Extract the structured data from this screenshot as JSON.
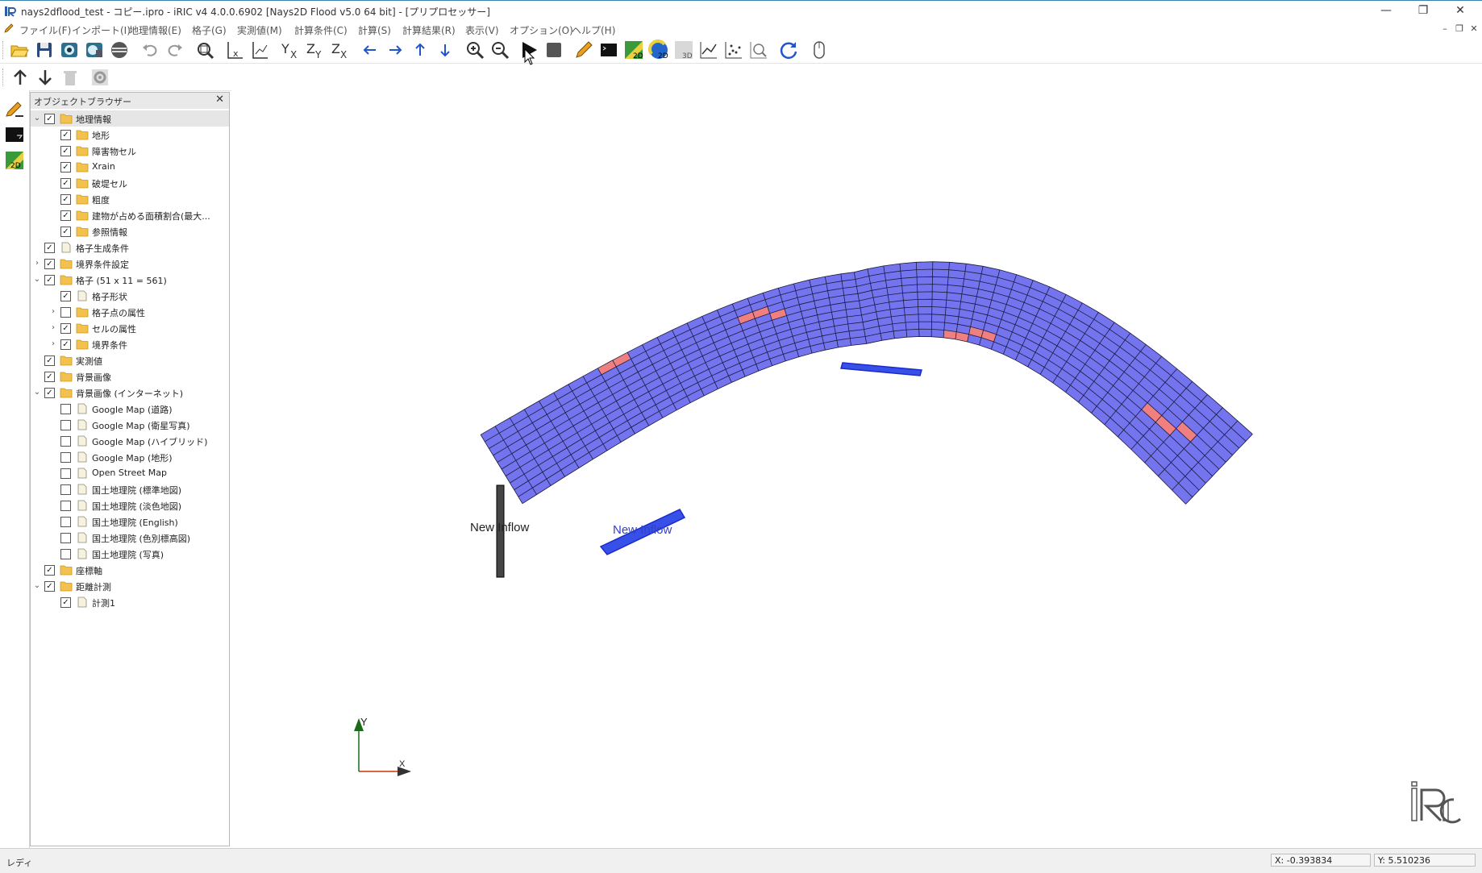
{
  "window": {
    "title": "nays2dflood_test - コピー.ipro - iRIC v4 4.0.0.6902 [Nays2D Flood v5.0 64 bit] - [プリプロセッサー]",
    "controls": {
      "minimize": "—",
      "restore": "❐",
      "close": "✕"
    }
  },
  "menu": [
    {
      "label": "ファイル(F)"
    },
    {
      "label": "インポート(I)"
    },
    {
      "label": "地理情報(E)"
    },
    {
      "label": "格子(G)"
    },
    {
      "label": "実測値(M)"
    },
    {
      "label": "計算条件(C)"
    },
    {
      "label": "計算(S)"
    },
    {
      "label": "計算結果(R)"
    },
    {
      "label": "表示(V)"
    },
    {
      "label": "オプション(O)"
    },
    {
      "label": "ヘルプ(H)"
    }
  ],
  "toolbar_icons": [
    "open-folder-icon",
    "save-icon",
    "camera-icon",
    "snapshot-icon",
    "background-icon",
    "undo-icon",
    "redo-icon",
    "fit-view-icon",
    "reset-rotation-icon",
    "axes-icon",
    "view-yx-icon",
    "view-zy-icon",
    "view-zx-icon",
    "move-left-icon",
    "move-right-icon",
    "move-up-icon",
    "move-down-icon",
    "zoom-in-icon",
    "zoom-out-icon",
    "run-icon",
    "stop-icon",
    "pencil-icon",
    "terminal-icon",
    "2d-contour-icon",
    "2d-vector-icon",
    "3d-view-icon",
    "graph-icon",
    "scatter-icon",
    "probe-icon",
    "reload-icon",
    "mouse-icon"
  ],
  "object_browser": {
    "title": "オブジェクトブラウザー",
    "close": "✕",
    "items": [
      {
        "label": "地理情報",
        "depth": 0,
        "expander": "open",
        "checked": true,
        "icon": "folder",
        "selected": true
      },
      {
        "label": "地形",
        "depth": 1,
        "expander": "none",
        "checked": true,
        "icon": "folder"
      },
      {
        "label": "障害物セル",
        "depth": 1,
        "expander": "none",
        "checked": true,
        "icon": "folder"
      },
      {
        "label": "Xrain",
        "depth": 1,
        "expander": "none",
        "checked": true,
        "icon": "folder"
      },
      {
        "label": "破堤セル",
        "depth": 1,
        "expander": "none",
        "checked": true,
        "icon": "folder"
      },
      {
        "label": "粗度",
        "depth": 1,
        "expander": "none",
        "checked": true,
        "icon": "folder"
      },
      {
        "label": "建物が占める面積割合(最大...",
        "depth": 1,
        "expander": "none",
        "checked": true,
        "icon": "folder"
      },
      {
        "label": "参照情報",
        "depth": 1,
        "expander": "none",
        "checked": true,
        "icon": "folder"
      },
      {
        "label": "格子生成条件",
        "depth": 0,
        "expander": "none",
        "checked": true,
        "icon": "file"
      },
      {
        "label": "境界条件設定",
        "depth": 0,
        "expander": "closed",
        "checked": true,
        "icon": "folder"
      },
      {
        "label": "格子 (51 x 11 = 561)",
        "depth": 0,
        "expander": "open",
        "checked": true,
        "icon": "folder"
      },
      {
        "label": "格子形状",
        "depth": 1,
        "expander": "none",
        "checked": true,
        "icon": "file"
      },
      {
        "label": "格子点の属性",
        "depth": 1,
        "expander": "closed",
        "checked": false,
        "icon": "folder"
      },
      {
        "label": "セルの属性",
        "depth": 1,
        "expander": "closed",
        "checked": true,
        "icon": "folder"
      },
      {
        "label": "境界条件",
        "depth": 1,
        "expander": "closed",
        "checked": true,
        "icon": "folder"
      },
      {
        "label": "実測値",
        "depth": 0,
        "expander": "none",
        "checked": true,
        "icon": "folder"
      },
      {
        "label": "背景画像",
        "depth": 0,
        "expander": "none",
        "checked": true,
        "icon": "folder"
      },
      {
        "label": "背景画像 (インターネット)",
        "depth": 0,
        "expander": "open",
        "checked": true,
        "icon": "folder"
      },
      {
        "label": "Google Map (道路)",
        "depth": 1,
        "expander": "none",
        "checked": false,
        "icon": "file"
      },
      {
        "label": "Google Map (衛星写真)",
        "depth": 1,
        "expander": "none",
        "checked": false,
        "icon": "file"
      },
      {
        "label": "Google Map (ハイブリッド)",
        "depth": 1,
        "expander": "none",
        "checked": false,
        "icon": "file"
      },
      {
        "label": "Google Map (地形)",
        "depth": 1,
        "expander": "none",
        "checked": false,
        "icon": "file"
      },
      {
        "label": "Open Street Map",
        "depth": 1,
        "expander": "none",
        "checked": false,
        "icon": "file"
      },
      {
        "label": "国土地理院 (標準地図)",
        "depth": 1,
        "expander": "none",
        "checked": false,
        "icon": "file"
      },
      {
        "label": "国土地理院 (淡色地図)",
        "depth": 1,
        "expander": "none",
        "checked": false,
        "icon": "file"
      },
      {
        "label": "国土地理院 (English)",
        "depth": 1,
        "expander": "none",
        "checked": false,
        "icon": "file"
      },
      {
        "label": "国土地理院 (色別標高図)",
        "depth": 1,
        "expander": "none",
        "checked": false,
        "icon": "file"
      },
      {
        "label": "国土地理院 (写真)",
        "depth": 1,
        "expander": "none",
        "checked": false,
        "icon": "file"
      },
      {
        "label": "座標軸",
        "depth": 0,
        "expander": "none",
        "checked": true,
        "icon": "folder"
      },
      {
        "label": "距離計測",
        "depth": 0,
        "expander": "open",
        "checked": true,
        "icon": "folder"
      },
      {
        "label": "計測1",
        "depth": 1,
        "expander": "none",
        "checked": true,
        "icon": "file"
      }
    ]
  },
  "canvas": {
    "inflow_label_1": "New Inflow",
    "inflow_label_2": "New Inflow",
    "axis_y": "Y",
    "axis_x": "X",
    "grid": {
      "i_nodes": 51,
      "j_nodes": 11
    },
    "colors": {
      "cell": "#7474ee",
      "cell_line": "#1a1a40",
      "obstacle": "#f08080",
      "inflow": "#2a3fe0",
      "axis_x": "#cc3300",
      "axis_y": "#1a6a1a"
    },
    "logo": "iRIC"
  },
  "status": {
    "text": "レディ",
    "x": "X: -0.393834",
    "y": "Y: 5.510236"
  }
}
